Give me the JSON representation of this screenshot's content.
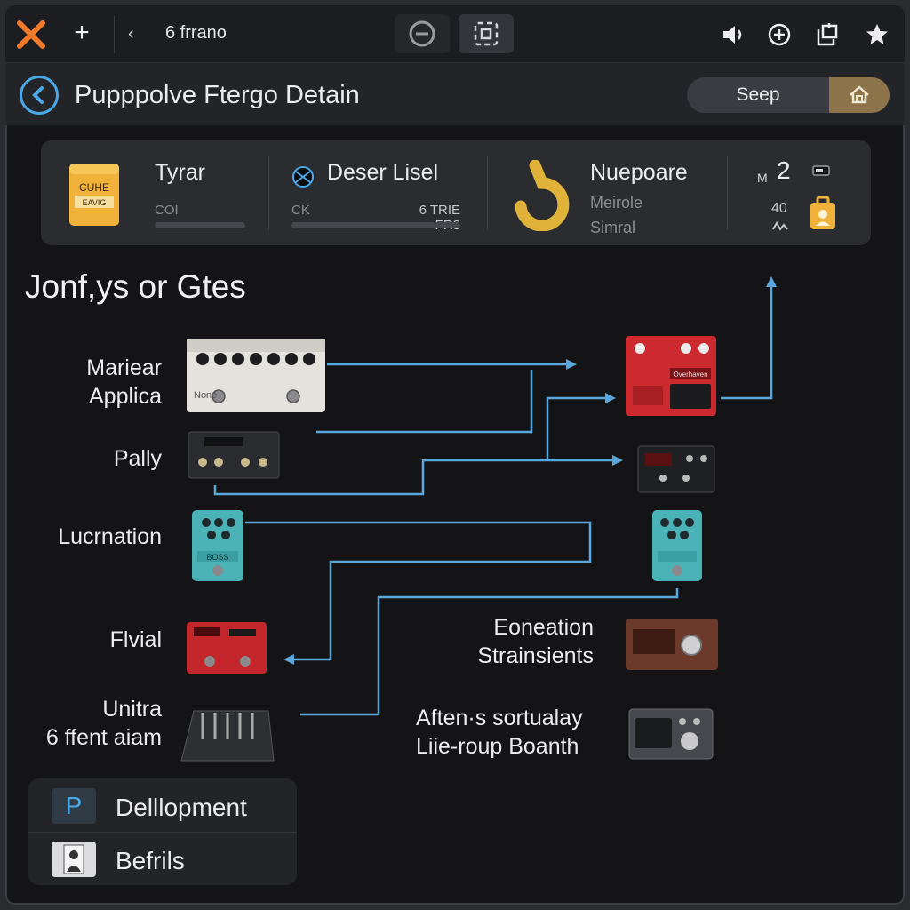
{
  "toolbar": {
    "title": "6 frrano",
    "close_icon": "x-icon",
    "add_icon": "plus-icon",
    "back_glyph": "‹"
  },
  "header": {
    "title": "Pupppolve Ftergo Detain",
    "button_label": "Seep"
  },
  "stats": {
    "card1": {
      "label": "Tyrar",
      "sub": "COI",
      "badge_top": "CUHE",
      "badge_bottom": "EAVIG"
    },
    "card2": {
      "label": "Deser Lisel",
      "sub_left": "CK",
      "sub_right": "6 TRIE FR8"
    },
    "card3": {
      "label": "Nuepoare",
      "sub1": "Meirole",
      "sub2": "Simral"
    },
    "card4": {
      "value_top": "2",
      "value_top_prefix": "M",
      "value_bottom": "40"
    }
  },
  "section": {
    "title": "Jonf,ys or Gtes"
  },
  "pedals_left": [
    {
      "label_line1": "Mariear",
      "label_line2": "Applica"
    },
    {
      "label_line1": "Pally",
      "label_line2": ""
    },
    {
      "label_line1": "Lucrnation",
      "label_line2": ""
    },
    {
      "label_line1": "Flvial",
      "label_line2": ""
    },
    {
      "label_line1": "Unitra",
      "label_line2": "6 ffent aiam"
    }
  ],
  "pedals_right": [
    {
      "label_line1": "Eoneation",
      "label_line2": "Strainsients"
    },
    {
      "label_line1": "Aften·s sortualay",
      "label_line2": "Liie-roup Boanth"
    }
  ],
  "pedal_text": {
    "white_pedal_brand": "None",
    "red_pedal_brand": "Overhaven",
    "teal_pedal_brand": "BOSS"
  },
  "legend": {
    "items": [
      {
        "icon_letter": "P",
        "label": "Delllopment"
      },
      {
        "icon_letter": "",
        "label": "Befrils"
      }
    ]
  },
  "colors": {
    "accent_blue": "#4aa8e6",
    "accent_orange": "#f07a2a",
    "accent_gold": "#e0b23a",
    "line_blue": "#5aa7dc"
  }
}
